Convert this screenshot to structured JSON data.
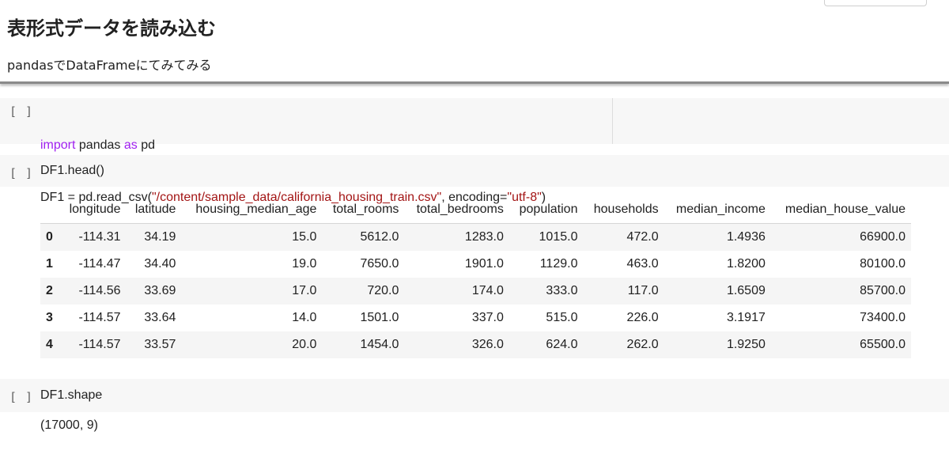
{
  "text_cell": {
    "heading": "表形式データを読み込む",
    "description": "pandasでDataFrameにてみてみる"
  },
  "run_button_label": "[ ]",
  "cell1": {
    "line1": {
      "kw1": "import",
      "mid": " pandas ",
      "kw2": "as",
      "end": " pd"
    },
    "line2": {
      "prefix": "DF1 = pd.read_csv(",
      "q1": "\"",
      "path": "/content/sample_data/california_housing_train.csv",
      "q2": "\"",
      "mid": ", encoding=",
      "enc": "\"utf-8\"",
      "suffix": ")"
    }
  },
  "cell2": {
    "code": "DF1.head()"
  },
  "dataframe": {
    "columns": [
      "longitude",
      "latitude",
      "housing_median_age",
      "total_rooms",
      "total_bedrooms",
      "population",
      "households",
      "median_income",
      "median_house_value"
    ],
    "rows": [
      {
        "index": "0",
        "values": [
          "-114.31",
          "34.19",
          "15.0",
          "5612.0",
          "1283.0",
          "1015.0",
          "472.0",
          "1.4936",
          "66900.0"
        ]
      },
      {
        "index": "1",
        "values": [
          "-114.47",
          "34.40",
          "19.0",
          "7650.0",
          "1901.0",
          "1129.0",
          "463.0",
          "1.8200",
          "80100.0"
        ]
      },
      {
        "index": "2",
        "values": [
          "-114.56",
          "33.69",
          "17.0",
          "720.0",
          "174.0",
          "333.0",
          "117.0",
          "1.6509",
          "85700.0"
        ]
      },
      {
        "index": "3",
        "values": [
          "-114.57",
          "33.64",
          "14.0",
          "1501.0",
          "337.0",
          "515.0",
          "226.0",
          "3.1917",
          "73400.0"
        ]
      },
      {
        "index": "4",
        "values": [
          "-114.57",
          "33.57",
          "20.0",
          "1454.0",
          "326.0",
          "624.0",
          "262.0",
          "1.9250",
          "65500.0"
        ]
      }
    ]
  },
  "cell3": {
    "code": "DF1.shape",
    "output": "(17000, 9)"
  }
}
